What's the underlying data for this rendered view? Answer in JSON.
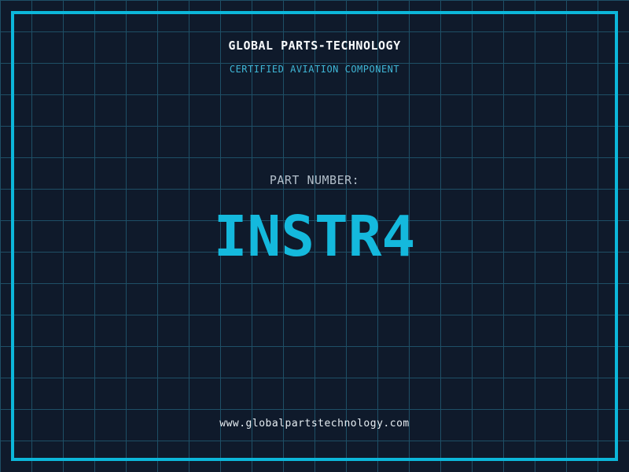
{
  "header": {
    "title": "GLOBAL PARTS-TECHNOLOGY",
    "subtitle": "CERTIFIED AVIATION COMPONENT"
  },
  "part": {
    "label": "PART NUMBER:",
    "number": "INSTR4"
  },
  "footer": {
    "website": "www.globalpartstechnology.com"
  },
  "colors": {
    "background": "#0f1a2b",
    "grid_line": "#1e4f66",
    "frame_border": "#0cb7da",
    "accent_cyan": "#14b9dd",
    "subtitle_cyan": "#3fb6d6",
    "title_white": "#f7f9fb",
    "label_gray": "#b3bfca",
    "website_white": "#e6edf2"
  }
}
